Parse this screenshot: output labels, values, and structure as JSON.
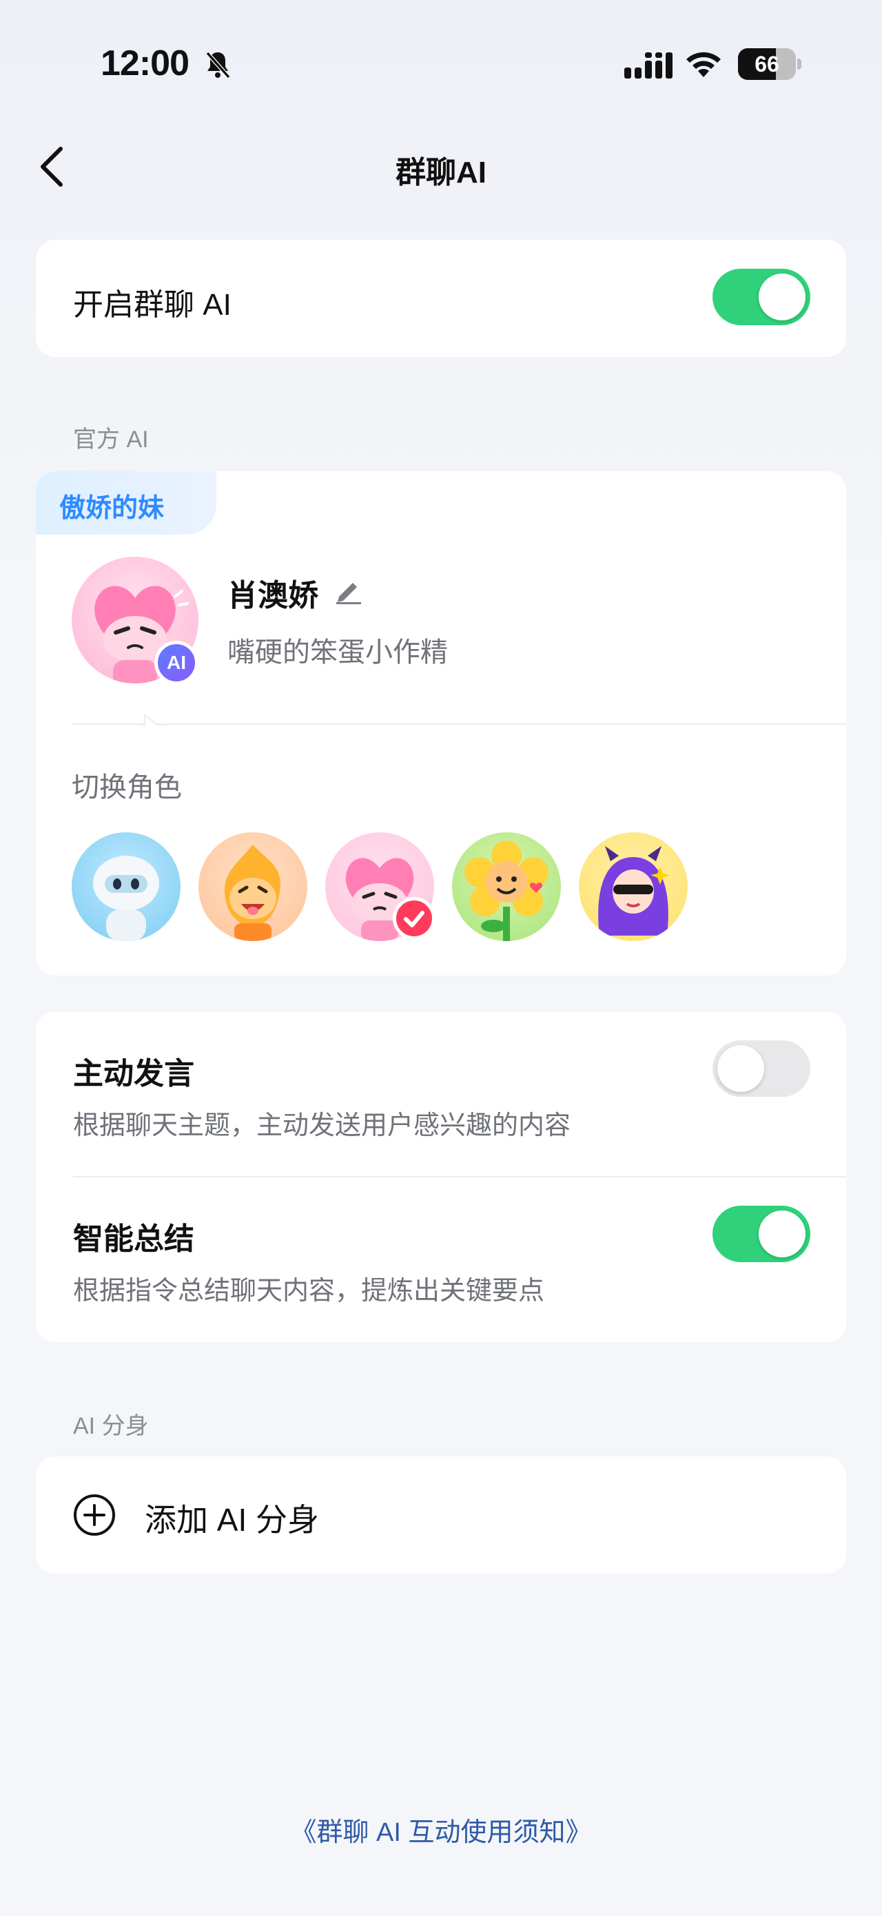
{
  "status_bar": {
    "time": "12:00",
    "battery_level": "66",
    "battery_fraction": 0.66,
    "icons": [
      "bell-muted-icon",
      "signal-icon",
      "wifi-icon",
      "battery-icon"
    ]
  },
  "nav": {
    "title": "群聊AI",
    "back_icon": "chevron-left-icon"
  },
  "enable_card": {
    "label": "开启群聊 AI",
    "enabled": true
  },
  "official_section": {
    "label": "官方 AI",
    "tag": "傲娇的妹",
    "character": {
      "name": "肖澳娇",
      "description": "嘴硬的笨蛋小作精",
      "badge": "AI"
    },
    "switch_label": "切换角色",
    "roles": [
      {
        "id": "robot",
        "selected": false
      },
      {
        "id": "flame",
        "selected": false
      },
      {
        "id": "heart",
        "selected": true
      },
      {
        "id": "flower",
        "selected": false
      },
      {
        "id": "devil-girl",
        "selected": false
      }
    ]
  },
  "settings_card": {
    "items": [
      {
        "title": "主动发言",
        "subtitle": "根据聊天主题，主动发送用户感兴趣的内容",
        "enabled": false
      },
      {
        "title": "智能总结",
        "subtitle": "根据指令总结聊天内容，提炼出关键要点",
        "enabled": true
      }
    ]
  },
  "clone_section": {
    "label": "AI 分身",
    "add_label": "添加 AI 分身"
  },
  "footer": {
    "link": "《群聊 AI 互动使用须知》"
  },
  "colors": {
    "toggle_on": "#2fd27a",
    "toggle_off": "#e8e8ea",
    "tag_text": "#2f8bff",
    "link": "#2e5aa8",
    "check_badge": "#ff3b5c"
  }
}
